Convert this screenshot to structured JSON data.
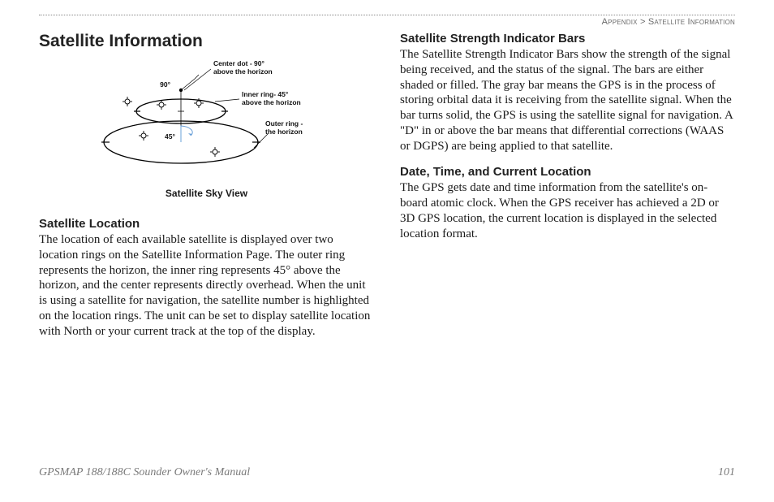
{
  "breadcrumb": {
    "left": "Appendix",
    "sep": ">",
    "right": "Satellite Information"
  },
  "h1": "Satellite Information",
  "figure": {
    "label_center": "Center dot - 90° above the horizon",
    "label_inner": "Inner ring- 45° above the horizon",
    "label_outer": "Outer ring - the horizon",
    "angle_90": "90°",
    "angle_45": "45°",
    "caption": "Satellite Sky View"
  },
  "left": {
    "h2_location": "Satellite Location",
    "p_location": "The location of each available satellite is displayed over two location rings on the Satellite Information Page. The outer ring represents the horizon, the inner ring represents 45° above the horizon, and the center represents directly overhead. When the unit is using a satellite for navigation, the satellite number is highlighted on the location rings. The unit can be set to display satellite location with North or your current track at the top of the display."
  },
  "right": {
    "h2_bars": "Satellite Strength Indicator Bars",
    "p_bars": "The Satellite Strength Indicator Bars show the strength of the signal being received, and the status of the signal. The bars are either shaded or filled. The gray bar means the GPS is in the process of storing orbital data it is receiving from the satellite signal. When the bar turns solid, the GPS is using the satellite signal for navigation. A \"D\" in or above the bar means that differential corrections (WAAS or DGPS) are being applied to that satellite.",
    "h2_date": "Date, Time, and Current Location",
    "p_date": "The GPS gets date and time information from the satellite's on-board atomic clock. When the GPS receiver has achieved a 2D or 3D GPS location, the current location is displayed in the selected location format."
  },
  "footer": {
    "manual": "GPSMAP 188/188C Sounder Owner's Manual",
    "page": "101"
  }
}
